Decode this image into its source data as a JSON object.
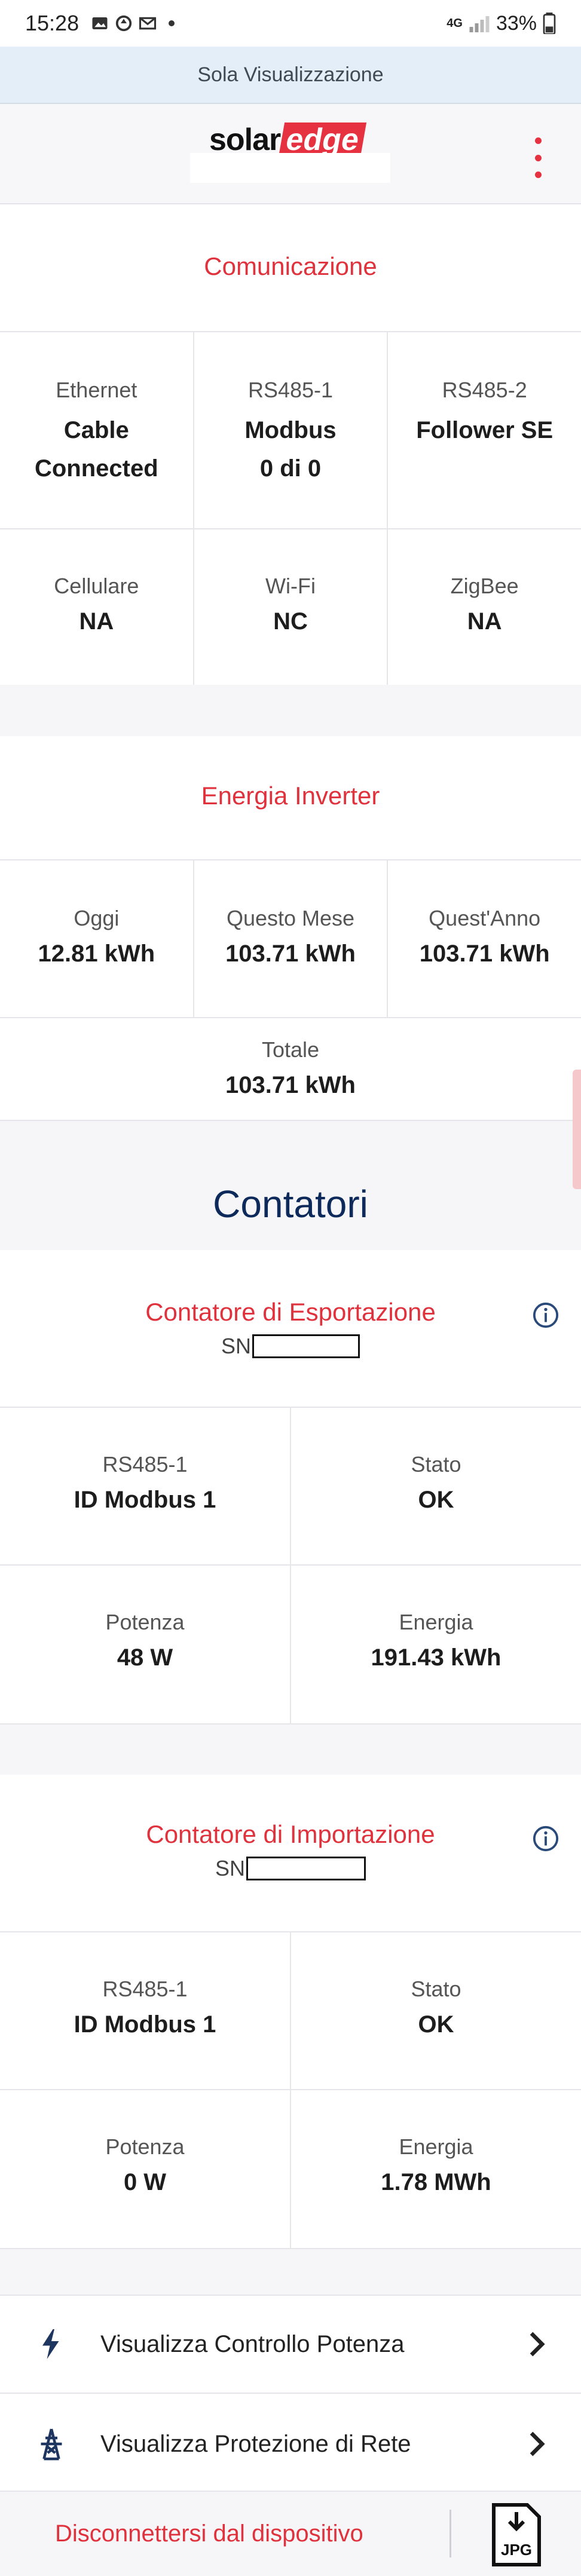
{
  "status_bar": {
    "time": "15:28",
    "network": "4G",
    "battery": "33%"
  },
  "view_only_banner": "Sola Visualizzazione",
  "brand": {
    "logo_text_solar": "solar",
    "logo_text_edge": "edge"
  },
  "communication": {
    "title": "Comunicazione",
    "rows": [
      [
        {
          "label": "Ethernet",
          "value": "Cable Connected"
        },
        {
          "label": "RS485-1",
          "value": "Modbus 0 di 0"
        },
        {
          "label": "RS485-2",
          "value": "Follower SE"
        }
      ],
      [
        {
          "label": "Cellulare",
          "value": "NA"
        },
        {
          "label": "Wi-Fi",
          "value": "NC"
        },
        {
          "label": "ZigBee",
          "value": "NA"
        }
      ]
    ]
  },
  "inverter_energy": {
    "title": "Energia Inverter",
    "row": [
      {
        "label": "Oggi",
        "value": "12.81 kWh"
      },
      {
        "label": "Questo Mese",
        "value": "103.71 kWh"
      },
      {
        "label": "Quest'Anno",
        "value": "103.71 kWh"
      }
    ],
    "total": {
      "label": "Totale",
      "value": "103.71 kWh"
    }
  },
  "meters_title": "Contatori",
  "export_meter": {
    "title": "Contatore di Esportazione",
    "sn_label": "SN",
    "cells": [
      {
        "label": "RS485-1",
        "value": "ID Modbus 1"
      },
      {
        "label": "Stato",
        "value": "OK"
      },
      {
        "label": "Potenza",
        "value": "48 W"
      },
      {
        "label": "Energia",
        "value": "191.43 kWh"
      }
    ]
  },
  "import_meter": {
    "title": "Contatore di Importazione",
    "sn_label": "SN",
    "cells": [
      {
        "label": "RS485-1",
        "value": "ID Modbus 1"
      },
      {
        "label": "Stato",
        "value": "OK"
      },
      {
        "label": "Potenza",
        "value": "0 W"
      },
      {
        "label": "Energia",
        "value": "1.78 MWh"
      }
    ]
  },
  "links": [
    {
      "label": "Visualizza Controllo Potenza",
      "icon": "lightning-icon"
    },
    {
      "label": "Visualizza Protezione di Rete",
      "icon": "power-tower-icon"
    }
  ],
  "footer": {
    "disconnect_label": "Disconnettersi dal dispositivo",
    "jpg_label": "JPG"
  },
  "colors": {
    "accent_red": "#e0323c",
    "navy": "#0d2a5a",
    "banner_blue": "#e3eef8"
  }
}
